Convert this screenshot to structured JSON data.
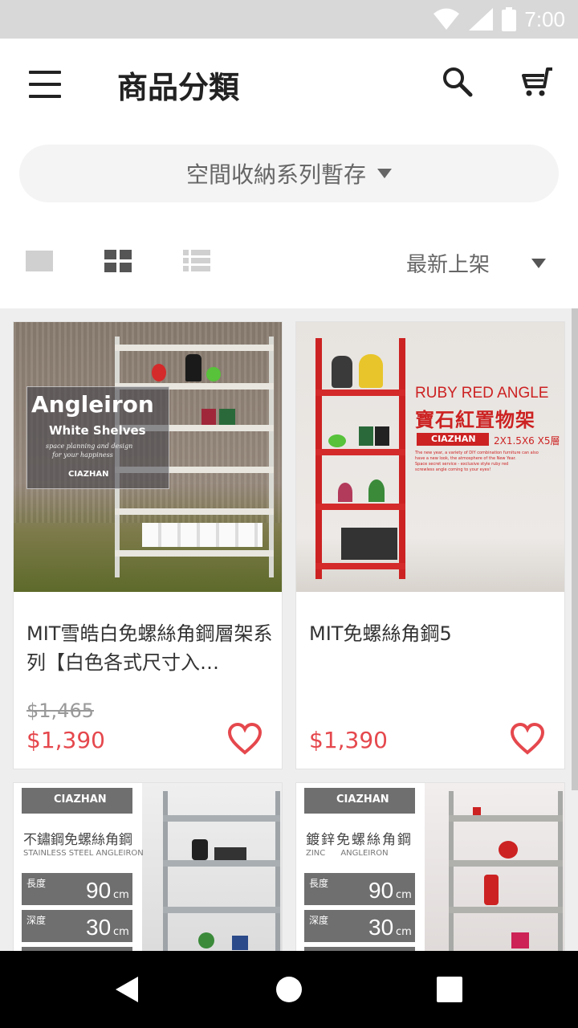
{
  "status_bar": {
    "time": "7:00"
  },
  "header": {
    "title": "商品分類"
  },
  "category": {
    "label": "空間收納系列暫存"
  },
  "sort": {
    "label": "最新上架"
  },
  "products": [
    {
      "name": "MIT雪皓白免螺絲角鋼層架系列【白色各式尺寸入…",
      "old_price": "$1,465",
      "price": "$1,390",
      "image": {
        "title": "Angleiron",
        "subtitle": "White Shelves",
        "tagline1": "space planning and design",
        "tagline2": "for your happiness",
        "brand": "CIAZHAN"
      }
    },
    {
      "name": "MIT免螺絲角鋼5",
      "price": "$1,390",
      "image": {
        "title_en": "RUBY RED ANGLE",
        "title_zh": "寶石紅置物架",
        "brand": "CIAZHAN",
        "size": "2X1.5X6  X5層",
        "desc1": "The new year, a variety of DIY combination furniture can also",
        "desc2": "have a new look, the atmosphere of the New Year.",
        "desc3": "Space secret service - exclusive style ruby red",
        "desc4": "screwless angle coming to your eyes!"
      }
    },
    {
      "image": {
        "brand": "CIAZHAN",
        "title_zh": "不鏽鋼免螺絲角鋼",
        "title_en": "STAINLESS STEEL   ANGLEIRON",
        "length_label": "長度",
        "length_value": "90",
        "unit": "cm",
        "depth_label": "深度",
        "depth_value": "30"
      }
    },
    {
      "image": {
        "brand": "CIAZHAN",
        "title_zh": "鍍鋅免螺絲角鋼",
        "title_en": "ZINC      ANGLEIRON",
        "length_label": "長度",
        "length_value": "90",
        "unit": "cm",
        "depth_label": "深度",
        "depth_value": "30"
      }
    }
  ],
  "colors": {
    "price": "#e5484d",
    "accent_red": "#d42a2a",
    "status_bar": "#d8d8d8"
  }
}
